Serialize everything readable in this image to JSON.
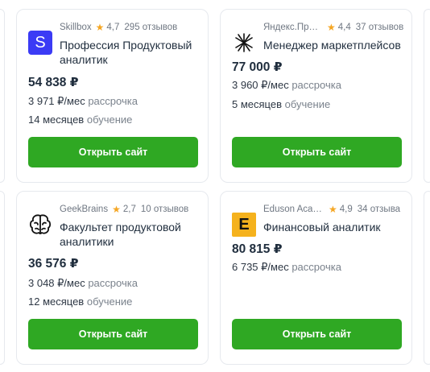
{
  "cards": [
    {
      "school": "Skillbox",
      "rating": "4,7",
      "reviews": "295 отзывов",
      "title": "Профессия Продуктовый аналитик",
      "price": "54 838 ₽",
      "installment_value": "3 971 ₽/мес",
      "installment_label": "рассрочка",
      "duration_value": "14 месяцев",
      "duration_label": "обучение",
      "button": "Открыть сайт",
      "logo_letter": "S",
      "logo_color": "#3b3bf5"
    },
    {
      "school": "Яндекс.Практикум",
      "rating": "4,4",
      "reviews": "37 отзывов",
      "title": "Менеджер маркетплейсов",
      "price": "77 000 ₽",
      "installment_value": "3 960 ₽/мес",
      "installment_label": "рассрочка",
      "duration_value": "5 месяцев",
      "duration_label": "обучение",
      "button": "Открыть сайт",
      "logo_icon": "asterisk-icon"
    },
    {
      "school": "GeekBrains",
      "rating": "2,7",
      "reviews": "10 отзывов",
      "title": "Факультет продуктовой аналитики",
      "price": "36 576 ₽",
      "installment_value": "3 048 ₽/мес",
      "installment_label": "рассрочка",
      "duration_value": "12 месяцев",
      "duration_label": "обучение",
      "button": "Открыть сайт",
      "logo_icon": "brain-icon"
    },
    {
      "school": "Eduson Academy",
      "rating": "4,9",
      "reviews": "34 отзыва",
      "title": "Финансовый аналитик",
      "price": "80 815 ₽",
      "installment_value": "6 735 ₽/мес",
      "installment_label": "рассрочка",
      "button": "Открыть сайт",
      "logo_letter": "E",
      "logo_color": "#f5b21d"
    }
  ],
  "colors": {
    "button": "#2fa823",
    "star": "#f5a623"
  }
}
